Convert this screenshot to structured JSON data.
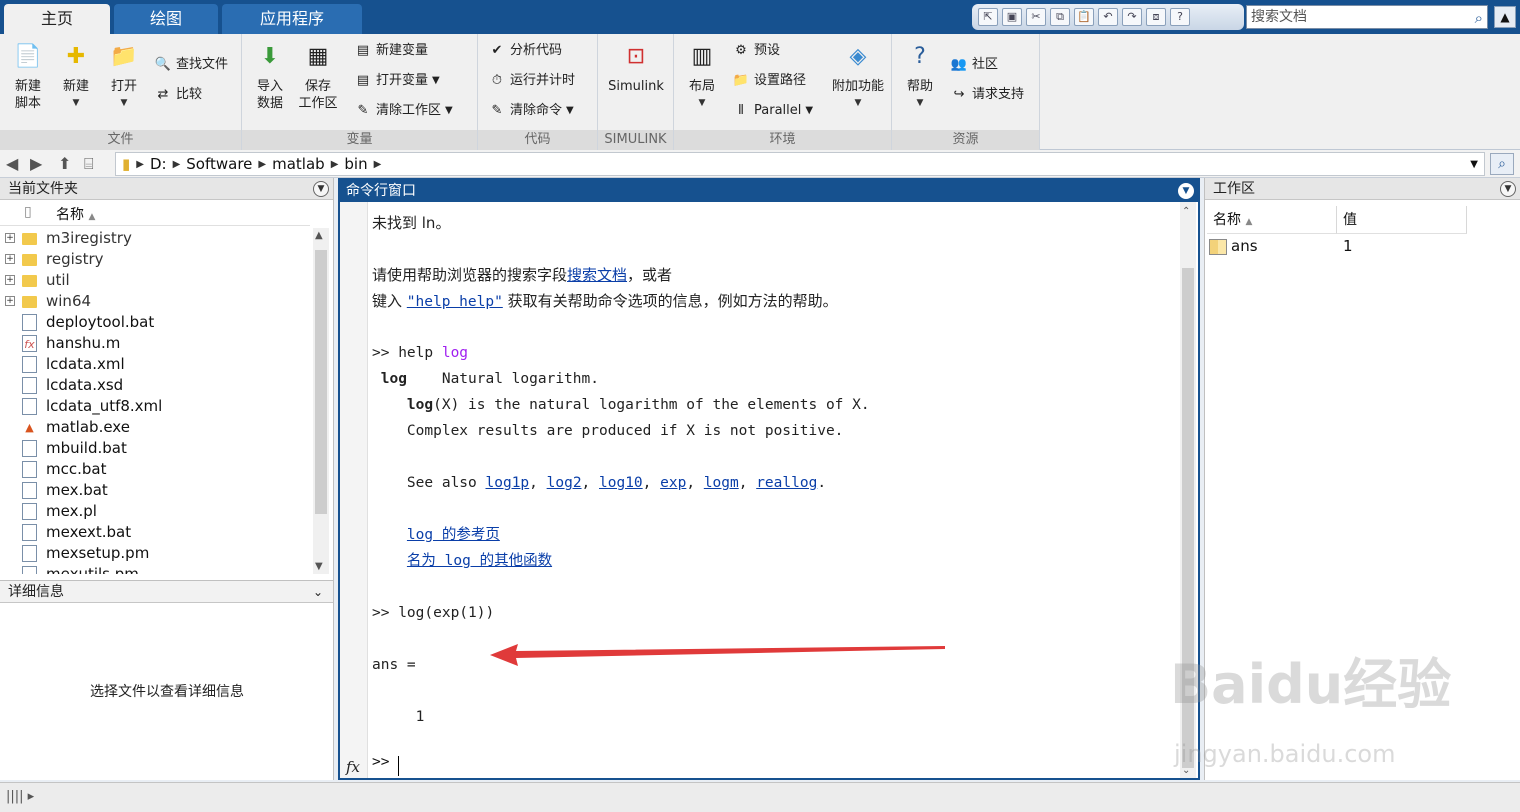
{
  "tabs": [
    {
      "label": "主页"
    },
    {
      "label": "绘图"
    },
    {
      "label": "应用程序"
    }
  ],
  "search_doc": {
    "placeholder": "搜索文档"
  },
  "ribbon": {
    "file": {
      "label": "文件",
      "new_script": "新建\n脚本",
      "new": "新建",
      "open": "打开",
      "find_files": "查找文件",
      "compare": "比较"
    },
    "variable": {
      "label": "变量",
      "import": "导入\n数据",
      "save": "保存\n工作区",
      "new_var": "新建变量",
      "open_var": "打开变量",
      "clear_ws": "清除工作区"
    },
    "code": {
      "label": "代码",
      "analyze": "分析代码",
      "run_time": "运行并计时",
      "clear_cmd": "清除命令"
    },
    "simulink": {
      "label": "SIMULINK",
      "btn": "Simulink"
    },
    "env": {
      "label": "环境",
      "layout": "布局",
      "prefs": "预设",
      "set_path": "设置路径",
      "parallel": "Parallel",
      "addons": "附加功能"
    },
    "resources": {
      "label": "资源",
      "help": "帮助",
      "community": "社区",
      "support": "请求支持"
    }
  },
  "address": {
    "segments": [
      "D:",
      "Software",
      "matlab",
      "bin"
    ]
  },
  "file_panel": {
    "title": "当前文件夹",
    "col_name": "名称",
    "items": [
      {
        "name": "m3iregistry",
        "kind": "folder"
      },
      {
        "name": "registry",
        "kind": "folder"
      },
      {
        "name": "util",
        "kind": "folder"
      },
      {
        "name": "win64",
        "kind": "folder"
      },
      {
        "name": "deploytool.bat",
        "kind": "file"
      },
      {
        "name": "hanshu.m",
        "kind": "mfile"
      },
      {
        "name": "lcdata.xml",
        "kind": "file"
      },
      {
        "name": "lcdata.xsd",
        "kind": "file"
      },
      {
        "name": "lcdata_utf8.xml",
        "kind": "file"
      },
      {
        "name": "matlab.exe",
        "kind": "exe"
      },
      {
        "name": "mbuild.bat",
        "kind": "file"
      },
      {
        "name": "mcc.bat",
        "kind": "file"
      },
      {
        "name": "mex.bat",
        "kind": "file"
      },
      {
        "name": "mex.pl",
        "kind": "file"
      },
      {
        "name": "mexext.bat",
        "kind": "file"
      },
      {
        "name": "mexsetup.pm",
        "kind": "file"
      },
      {
        "name": "mexutils.pm",
        "kind": "file"
      }
    ]
  },
  "details_panel": {
    "title": "详细信息",
    "message": "选择文件以查看详细信息"
  },
  "command_window": {
    "title": "命令行窗口",
    "lines": {
      "l1": "未找到 ln。",
      "l2a": "请使用帮助浏览器的搜索字段",
      "l2link": "搜索文档",
      "l2b": "，或者",
      "l3a": "键入 ",
      "l3link": "\"help help\"",
      "l3b": " 获取有关帮助命令选项的信息，例如方法的帮助。",
      "l4a": ">> help ",
      "l4kw": "log",
      "l5bold": " log",
      "l5": "    Natural logarithm.",
      "l6bold": "    log",
      "l6": "(X) is the natural logarithm of the elements of X.",
      "l7": "    Complex results are produced if X is not positive.",
      "l8": "    See also ",
      "see_also": [
        "log1p",
        "log2",
        "log10",
        "exp",
        "logm",
        "reallog"
      ],
      "ref_page": "log 的参考页",
      "other_funcs": "名为 log 的其他函数",
      "cmd2": ">> log(exp(1))",
      "ans": "ans =",
      "val": "     1"
    },
    "prompt": ">>",
    "fx": "fx"
  },
  "workspace": {
    "title": "工作区",
    "col_name": "名称",
    "col_value": "值",
    "rows": [
      {
        "name": "ans",
        "value": "1"
      }
    ]
  },
  "watermark": {
    "logo": "Baidu经验",
    "site": "jingyan.baidu.com"
  },
  "colors": {
    "accent": "#16518f",
    "link": "#0a3ea8",
    "keyword": "#a020f0",
    "arrow": "#e03a3a"
  }
}
